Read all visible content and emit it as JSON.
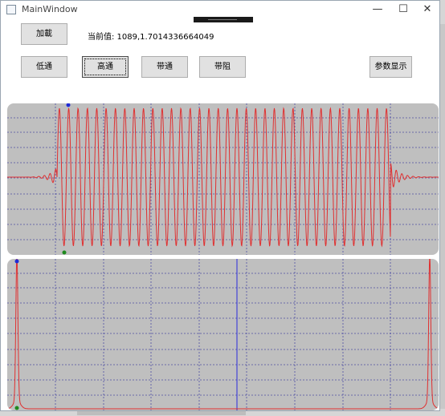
{
  "window": {
    "title": "MainWindow",
    "minimize": "—",
    "maximize": "☐",
    "close": "✕"
  },
  "toolbar": {
    "load_label": "加載",
    "current_value": "当前值: 1089,1.7014336664049",
    "lowpass_label": "低通",
    "highpass_label": "高通",
    "bandpass_label": "带通",
    "bandstop_label": "带阻",
    "params_label": "参数显示"
  },
  "colors": {
    "plot_bg": "#bfbfbf",
    "grid": "#2b2b9a",
    "signal": "#e03030",
    "marker_blue": "#1f2bd6",
    "marker_green": "#1e8a1e",
    "cursor_line": "#2b2bdc"
  },
  "chart_data": [
    {
      "type": "line",
      "series": [
        {
          "values_description_free": true,
          "shape": "high-frequency burst between ~11% and ~89% of x range, amplitude ±1, tails decaying sinc-like"
        }
      ],
      "grid": true
    },
    {
      "type": "line",
      "series": [
        {
          "shape": "spectrum with two narrow spikes at both ends"
        }
      ],
      "grid": true
    }
  ]
}
